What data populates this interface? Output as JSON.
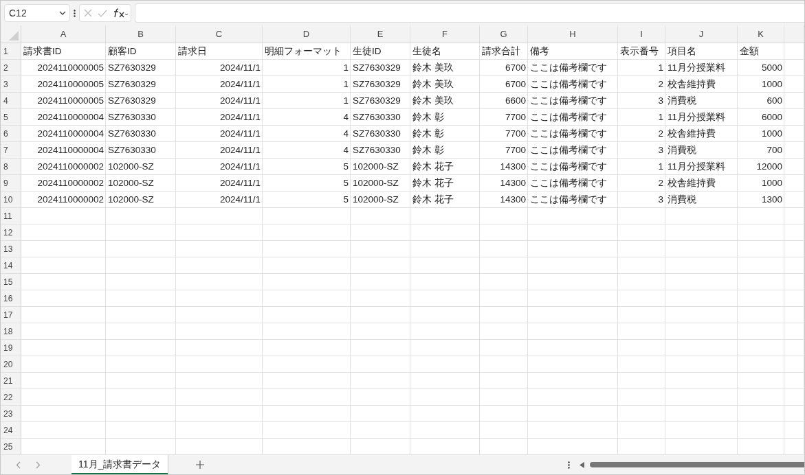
{
  "name_box": {
    "value": "C12"
  },
  "columns": [
    {
      "letter": "A",
      "numeric": true
    },
    {
      "letter": "B",
      "numeric": false
    },
    {
      "letter": "C",
      "numeric": true
    },
    {
      "letter": "D",
      "numeric": true
    },
    {
      "letter": "E",
      "numeric": false
    },
    {
      "letter": "F",
      "numeric": false
    },
    {
      "letter": "G",
      "numeric": true
    },
    {
      "letter": "H",
      "numeric": false
    },
    {
      "letter": "I",
      "numeric": true
    },
    {
      "letter": "J",
      "numeric": false
    },
    {
      "letter": "K",
      "numeric": true
    }
  ],
  "rows": [
    {
      "number": "1",
      "header": true,
      "cells": [
        "請求書ID",
        "顧客ID",
        "請求日",
        "明細フォーマット",
        "生徒ID",
        "生徒名",
        "請求合計",
        "備考",
        "表示番号",
        "項目名",
        "金額"
      ]
    },
    {
      "number": "2",
      "header": false,
      "cells": [
        "2024110000005",
        "SZ7630329",
        "2024/11/1",
        "1",
        "SZ7630329",
        "鈴木 美玖",
        "6700",
        "ここは備考欄です",
        "1",
        "11月分授業料",
        "5000"
      ]
    },
    {
      "number": "3",
      "header": false,
      "cells": [
        "2024110000005",
        "SZ7630329",
        "2024/11/1",
        "1",
        "SZ7630329",
        "鈴木 美玖",
        "6700",
        "ここは備考欄です",
        "2",
        "校舎維持費",
        "1000"
      ]
    },
    {
      "number": "4",
      "header": false,
      "cells": [
        "2024110000005",
        "SZ7630329",
        "2024/11/1",
        "1",
        "SZ7630329",
        "鈴木 美玖",
        "6600",
        "ここは備考欄です",
        "3",
        "消費税",
        "600"
      ]
    },
    {
      "number": "5",
      "header": false,
      "cells": [
        "2024110000004",
        "SZ7630330",
        "2024/11/1",
        "4",
        "SZ7630330",
        "鈴木 彰",
        "7700",
        "ここは備考欄です",
        "1",
        "11月分授業料",
        "6000"
      ]
    },
    {
      "number": "6",
      "header": false,
      "cells": [
        "2024110000004",
        "SZ7630330",
        "2024/11/1",
        "4",
        "SZ7630330",
        "鈴木 彰",
        "7700",
        "ここは備考欄です",
        "2",
        "校舎維持費",
        "1000"
      ]
    },
    {
      "number": "7",
      "header": false,
      "cells": [
        "2024110000004",
        "SZ7630330",
        "2024/11/1",
        "4",
        "SZ7630330",
        "鈴木 彰",
        "7700",
        "ここは備考欄です",
        "3",
        "消費税",
        "700"
      ]
    },
    {
      "number": "8",
      "header": false,
      "cells": [
        "2024110000002",
        "102000-SZ",
        "2024/11/1",
        "5",
        "102000-SZ",
        "鈴木 花子",
        "14300",
        "ここは備考欄です",
        "1",
        "11月分授業料",
        "12000"
      ]
    },
    {
      "number": "9",
      "header": false,
      "cells": [
        "2024110000002",
        "102000-SZ",
        "2024/11/1",
        "5",
        "102000-SZ",
        "鈴木 花子",
        "14300",
        "ここは備考欄です",
        "2",
        "校舎維持費",
        "1000"
      ]
    },
    {
      "number": "10",
      "header": false,
      "cells": [
        "2024110000002",
        "102000-SZ",
        "2024/11/1",
        "5",
        "102000-SZ",
        "鈴木 花子",
        "14300",
        "ここは備考欄です",
        "3",
        "消費税",
        "1300"
      ]
    },
    {
      "number": "11"
    },
    {
      "number": "12"
    },
    {
      "number": "13"
    },
    {
      "number": "14"
    },
    {
      "number": "15"
    },
    {
      "number": "16"
    },
    {
      "number": "17"
    },
    {
      "number": "18"
    },
    {
      "number": "19"
    },
    {
      "number": "20"
    },
    {
      "number": "21"
    },
    {
      "number": "22"
    },
    {
      "number": "23"
    },
    {
      "number": "24"
    },
    {
      "number": "25"
    }
  ],
  "sheet_tabs": [
    {
      "label": "11月_請求書データ",
      "selected": true
    }
  ]
}
